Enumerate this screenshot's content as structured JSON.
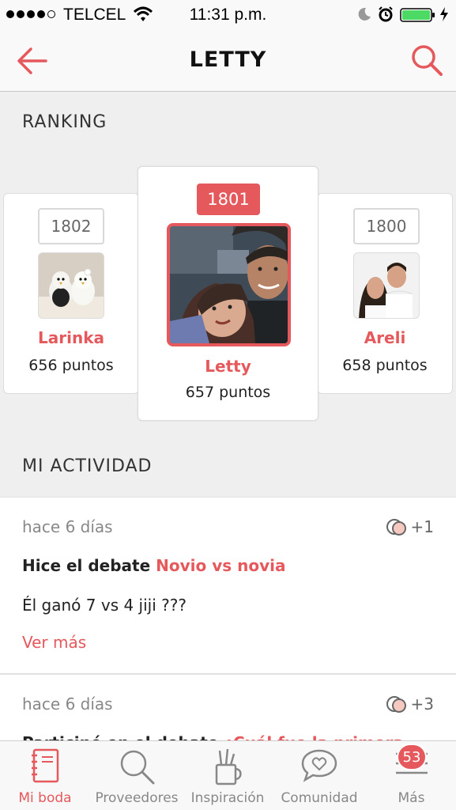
{
  "status_bar": {
    "carrier": "TELCEL",
    "time": "11:31 p.m."
  },
  "nav": {
    "title": "LETTY"
  },
  "ranking": {
    "section_title": "RANKING",
    "entries": [
      {
        "rank": "1802",
        "name": "Larinka",
        "points": "656 puntos"
      },
      {
        "rank": "1801",
        "name": "Letty",
        "points": "657 puntos"
      },
      {
        "rank": "1800",
        "name": "Areli",
        "points": "658 puntos"
      }
    ]
  },
  "activity": {
    "section_title": "MI ACTIVIDAD",
    "items": [
      {
        "time": "hace 6 días",
        "count": "+1",
        "headline_prefix": "Hice el debate ",
        "headline_link": "Novio vs novia",
        "text": "Él ganó 7 vs 4 jiji ???",
        "more": "Ver más"
      },
      {
        "time": "hace 6 días",
        "count": "+3",
        "headline_prefix": "Participé en el debate ",
        "headline_link": "¿Cuál fue la primera"
      }
    ]
  },
  "tabbar": {
    "tabs": [
      {
        "label": "Mi boda",
        "icon": "notebook-icon"
      },
      {
        "label": "Proveedores",
        "icon": "search-icon"
      },
      {
        "label": "Inspiración",
        "icon": "tools-icon"
      },
      {
        "label": "Comunidad",
        "icon": "heart-chat-icon"
      },
      {
        "label": "Más",
        "icon": "menu-icon"
      }
    ],
    "more_badge": "53"
  },
  "colors": {
    "accent": "#e5585c",
    "battery": "#4cd964"
  }
}
